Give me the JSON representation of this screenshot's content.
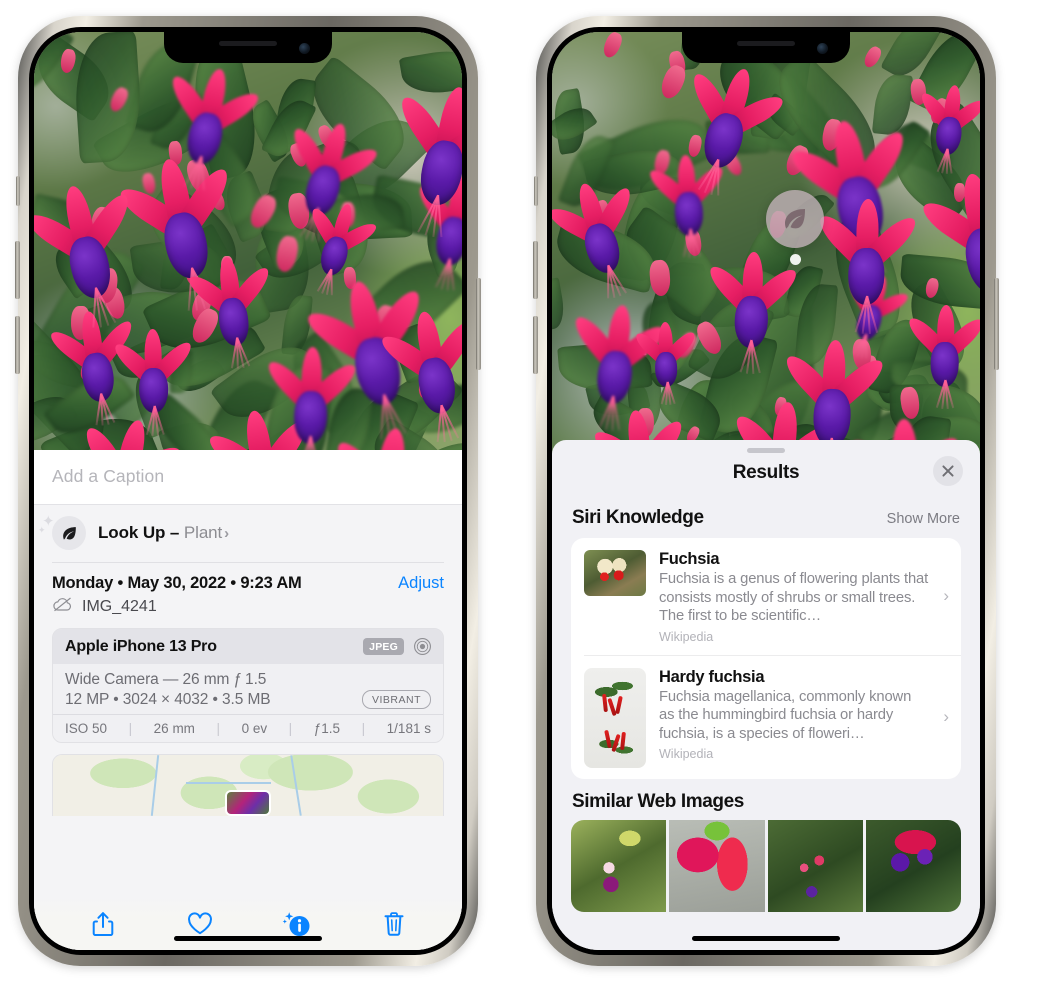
{
  "left_phone": {
    "photo": {
      "alt": "fuchsia-flowers-photo"
    },
    "caption_field": {
      "placeholder": "Add a Caption",
      "value": ""
    },
    "look_up": {
      "icon": "leaf-icon",
      "label": "Look Up",
      "dash": " – ",
      "category": "Plant",
      "chevron": "›"
    },
    "metadata": {
      "date": "Monday • May 30, 2022 • 9:23 AM",
      "adjust_label": "Adjust",
      "cloud_icon": "cloud-slash-icon",
      "filename": "IMG_4241"
    },
    "exif": {
      "device": "Apple iPhone 13 Pro",
      "format_badge": "JPEG",
      "aperture_icon": "aperture-icon",
      "lens_line": "Wide Camera — 26 mm ƒ 1.5",
      "specs_line": "12 MP • 3024 × 4032 • 3.5 MB",
      "style_badge": "VIBRANT",
      "settings": [
        "ISO 50",
        "26 mm",
        "0 ev",
        "ƒ1.5",
        "1/181 s"
      ]
    },
    "map": {
      "name": "location-map-thumbnail"
    },
    "toolbar": [
      {
        "name": "share-button",
        "icon": "share-icon",
        "label": "Share"
      },
      {
        "name": "favorite-button",
        "icon": "heart-icon",
        "label": "Favorite"
      },
      {
        "name": "visual-lookup-info-button",
        "icon": "info-sparkle-icon",
        "label": "Info",
        "active": true
      },
      {
        "name": "delete-button",
        "icon": "trash-icon",
        "label": "Delete"
      }
    ]
  },
  "right_phone": {
    "photo": {
      "alt": "fuchsia-flowers-photo"
    },
    "vision_badge": {
      "icon": "leaf-icon",
      "label": "Plant detected"
    },
    "results_sheet": {
      "grabber": "sheet-grabber",
      "title": "Results",
      "close_label": "✕",
      "siri_knowledge": {
        "section_title": "Siri Knowledge",
        "action_label": "Show More",
        "cards": [
          {
            "title": "Fuchsia",
            "description": "Fuchsia is a genus of flowering plants that consists mostly of shrubs or small trees. The first to be scientific…",
            "source": "Wikipedia",
            "chevron": "›"
          },
          {
            "title": "Hardy fuchsia",
            "description": "Fuchsia magellanica, commonly known as the hummingbird fuchsia or hardy fuchsia, is a species of floweri…",
            "source": "Wikipedia",
            "chevron": "›"
          }
        ]
      },
      "similar_web_images": {
        "section_title": "Similar Web Images",
        "thumbs": [
          {
            "name": "web-image-1"
          },
          {
            "name": "web-image-2"
          },
          {
            "name": "web-image-3"
          },
          {
            "name": "web-image-4"
          }
        ]
      }
    }
  },
  "colors": {
    "accent_blue": "#0a84ff",
    "sheet_bg": "#f1f1f5",
    "card_bg": "#ffffff",
    "secondary_text": "#8a8a90",
    "badge_gray": "#a9a9b0"
  }
}
